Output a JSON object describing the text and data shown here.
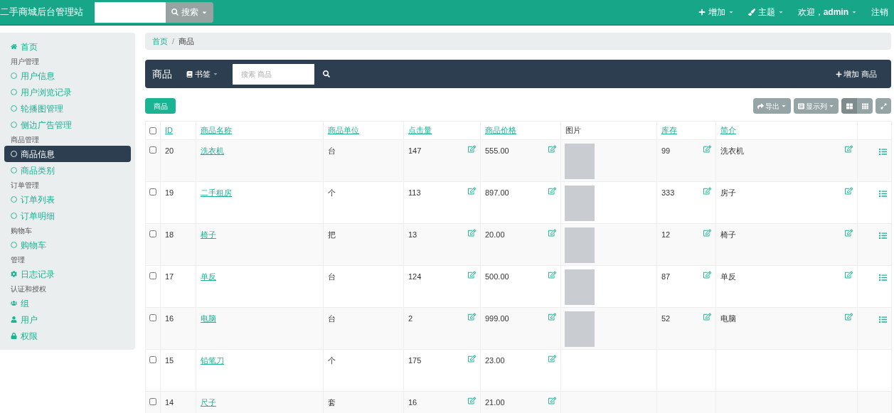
{
  "topbar": {
    "title": "二手商城后台管理站",
    "search_button": "搜索",
    "menu": [
      {
        "kind": "plus",
        "label": "增加",
        "caret": true
      },
      {
        "kind": "brush",
        "label": "主题",
        "caret": true
      },
      {
        "kind": "text",
        "label": "欢迎，**admin**",
        "caret": true
      },
      {
        "kind": "text",
        "label": "注销",
        "caret": false
      }
    ]
  },
  "sidebar": {
    "sections": [
      {
        "items": [
          {
            "kind": "home",
            "label": "首页",
            "selected": false
          }
        ]
      },
      {
        "heading": "用户管理",
        "items": [
          {
            "kind": "circle",
            "label": "用户信息",
            "selected": false
          },
          {
            "kind": "circle",
            "label": "用户浏览记录",
            "selected": false
          },
          {
            "kind": "circle",
            "label": "轮播图管理",
            "selected": false
          },
          {
            "kind": "circle",
            "label": "侧边广告管理",
            "selected": false
          }
        ]
      },
      {
        "heading": "商品管理",
        "items": [
          {
            "kind": "circle",
            "label": "商品信息",
            "selected": true
          },
          {
            "kind": "circle",
            "label": "商品类别",
            "selected": false
          }
        ]
      },
      {
        "heading": "订单管理",
        "items": [
          {
            "kind": "circle",
            "label": "订单列表",
            "selected": false
          },
          {
            "kind": "circle",
            "label": "订单明细",
            "selected": false
          }
        ]
      },
      {
        "heading": "购物车",
        "items": [
          {
            "kind": "circle",
            "label": "购物车",
            "selected": false
          }
        ]
      },
      {
        "heading": "管理",
        "items": [
          {
            "kind": "gear",
            "label": "日志记录",
            "selected": false
          }
        ]
      },
      {
        "heading": "认证和授权",
        "items": [
          {
            "kind": "users",
            "label": "组",
            "selected": false
          },
          {
            "kind": "user",
            "label": "用户",
            "selected": false
          },
          {
            "kind": "lock",
            "label": "权限",
            "selected": false
          }
        ]
      }
    ]
  },
  "breadcrumb": {
    "separator": "/",
    "items": [
      "首页",
      "商品"
    ]
  },
  "panel": {
    "title": "商品",
    "bookmark": "书签",
    "search_placeholder": "搜索 商品",
    "add_button": "增加 商品"
  },
  "toolbar": {
    "add_button": "商品",
    "export_button": "导出",
    "columns_button": "显示列",
    "views": [
      {
        "kind": "cards",
        "selected": true
      },
      {
        "kind": "table",
        "selected": false
      }
    ]
  },
  "table": {
    "all_checked": false,
    "columns": [
      {
        "label": "ID",
        "sortable": true
      },
      {
        "label": "商品名称",
        "sortable": true
      },
      {
        "label": "商品单位",
        "sortable": true
      },
      {
        "label": "点击量",
        "sortable": true
      },
      {
        "label": "商品价格",
        "sortable": true
      },
      {
        "label": "图片",
        "sortable": false
      },
      {
        "label": "库存",
        "sortable": true
      },
      {
        "label": "简介",
        "sortable": true
      }
    ],
    "rows": [
      {
        "checked": false,
        "id": "20",
        "name": "洗衣机",
        "unit": "台",
        "clicks": "147",
        "price": "555.00",
        "photo": true,
        "stock": "99",
        "desc": "洗衣机"
      },
      {
        "checked": false,
        "id": "19",
        "name": "二手租房",
        "unit": "个",
        "clicks": "113",
        "price": "897.00",
        "photo": true,
        "stock": "333",
        "desc": "房子"
      },
      {
        "checked": false,
        "id": "18",
        "name": "椅子",
        "unit": "把",
        "clicks": "13",
        "price": "20.00",
        "photo": true,
        "stock": "12",
        "desc": "椅子"
      },
      {
        "checked": false,
        "id": "17",
        "name": "单反",
        "unit": "台",
        "clicks": "124",
        "price": "500.00",
        "photo": true,
        "stock": "87",
        "desc": "单反"
      },
      {
        "checked": false,
        "id": "16",
        "name": "电脑",
        "unit": "台",
        "clicks": "2",
        "price": "999.00",
        "photo": true,
        "stock": "52",
        "desc": "电脑"
      },
      {
        "checked": false,
        "id": "15",
        "name": "铅笔刀",
        "unit": "个",
        "clicks": "175",
        "price": "23.00",
        "photo": false
      },
      {
        "checked": false,
        "id": "14",
        "name": "尺子",
        "unit": "套",
        "clicks": "16",
        "price": "21.00",
        "photo": false
      }
    ]
  }
}
